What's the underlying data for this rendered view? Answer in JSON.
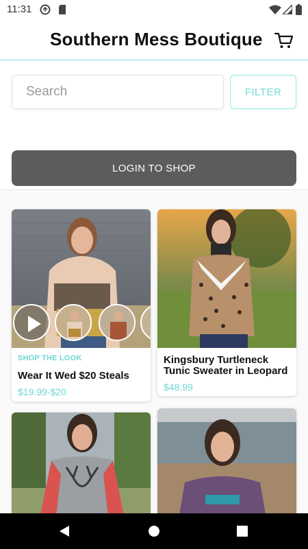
{
  "status": {
    "time": "11:31",
    "icons": [
      "sync-icon",
      "sd-card-icon",
      "wifi-icon",
      "signal-icon",
      "battery-icon"
    ]
  },
  "header": {
    "title": "Southern Mess Boutique",
    "cart_icon": "cart-icon"
  },
  "search": {
    "placeholder": "Search",
    "value": "",
    "filter_label": "FILTER"
  },
  "login": {
    "label": "LOGIN TO SHOP"
  },
  "products": [
    {
      "tag": "SHOP THE LOOK",
      "name": "Wear It Wed $20 Steals",
      "price": "$19.99-$20",
      "has_video": true
    },
    {
      "tag": "",
      "name": "Kingsbury Turtleneck Tunic Sweater in Leopard",
      "price": "$48.99",
      "has_video": false
    },
    {
      "tag": "",
      "name": "",
      "price": "",
      "has_video": false
    },
    {
      "tag": "",
      "name": "",
      "price": "",
      "has_video": false
    }
  ],
  "colors": {
    "accent": "#6ed7d3",
    "login_bg": "#5c5c5c",
    "divider": "#7fe3e0"
  },
  "navbar": {
    "icons": [
      "back-icon",
      "home-icon",
      "recents-icon"
    ]
  }
}
